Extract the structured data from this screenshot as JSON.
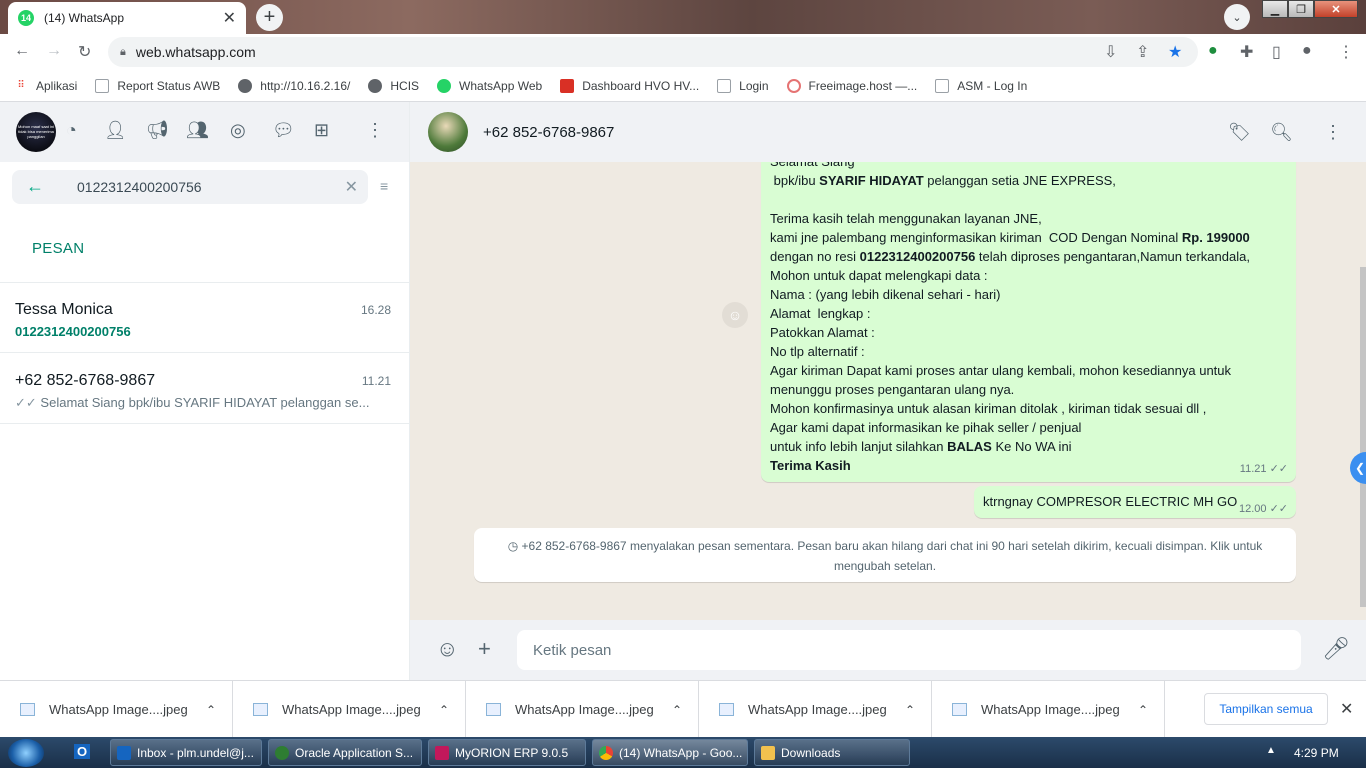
{
  "browser": {
    "tab_title": "(14) WhatsApp",
    "tab_badge": "14",
    "url": "web.whatsapp.com",
    "bookmarks": [
      {
        "label": "Aplikasi",
        "color": "#ea4335"
      },
      {
        "label": "Report Status AWB",
        "color": "#9aa0a6"
      },
      {
        "label": "http://10.16.2.16/",
        "color": "#5f6368"
      },
      {
        "label": "HCIS",
        "color": "#5f6368"
      },
      {
        "label": "WhatsApp Web",
        "color": "#25d366"
      },
      {
        "label": "Dashboard HVO HV...",
        "color": "#d93025"
      },
      {
        "label": "Login",
        "color": "#9aa0a6"
      },
      {
        "label": "Freeimage.host —...",
        "color": "#e57373"
      },
      {
        "label": "ASM - Log In",
        "color": "#9aa0a6"
      }
    ]
  },
  "sidebar": {
    "avatar_text": "Mohon maaf saat ini tidak bisa menerima panggilan",
    "search_value": "0122312400200756",
    "section_label": "PESAN",
    "chats": [
      {
        "name": "Tessa Monica",
        "time": "16.28",
        "subtitle": "0122312400200756"
      },
      {
        "name": "+62 852-6768-9867",
        "time": "11.21",
        "subtitle": "Selamat Siang   bpk/ibu SYARIF HIDAYAT pelanggan se..."
      }
    ]
  },
  "conversation": {
    "contact_name": "+62 852-6768-9867",
    "message1": {
      "line_greeting": "Selamat Siang",
      "salutation_pre": " bpk/ibu ",
      "salutation_name": "SYARIF HIDAYAT",
      "salutation_post": " pelanggan setia JNE EXPRESS,",
      "line_thanks": "Terima kasih telah menggunakan layanan JNE,",
      "cod_pre": "kami jne palembang menginformasikan kiriman  COD Dengan Nominal ",
      "cod_amount": "Rp. 199000",
      "cod_mid": " dengan no resi ",
      "cod_resi": "0122312400200756",
      "cod_post": " telah diproses pengantaran,Namun terkandala, Mohon untuk dapat melengkapi data :",
      "field_nama": "Nama : (yang lebih dikenal sehari - hari)",
      "field_alamat": "Alamat  lengkap :",
      "field_patokan": "Patokkan Alamat :",
      "field_tlp": "No tlp alternatif :",
      "line_agar": "Agar kiriman Dapat kami proses antar ulang kembali, mohon kesediannya untuk menunggu proses pengantaran ulang nya.",
      "line_konfirmasi": "Mohon konfirmasinya untuk alasan kiriman ditolak , kiriman tidak sesuai dll ,",
      "line_seller": "Agar kami dapat informasikan ke pihak seller / penjual",
      "balas_pre": "untuk info lebih lanjut silahkan ",
      "balas_word": "BALAS",
      "balas_post": " Ke No WA ini",
      "closing": "Terima Kasih",
      "time": "11.21"
    },
    "message2": {
      "text": "ktrngnay COMPRESOR ELECTRIC MH GO",
      "time": "12.00"
    },
    "system_notice": "+62 852-6768-9867 menyalakan pesan sementara. Pesan baru akan hilang dari chat ini 90 hari setelah dikirim, kecuali disimpan. Klik untuk mengubah setelan.",
    "input_placeholder": "Ketik pesan"
  },
  "downloads": {
    "items": [
      "WhatsApp Image....jpeg",
      "WhatsApp Image....jpeg",
      "WhatsApp Image....jpeg",
      "WhatsApp Image....jpeg",
      "WhatsApp Image....jpeg"
    ],
    "show_all": "Tampilkan semua"
  },
  "taskbar": {
    "items": [
      "Inbox - plm.undel@j...",
      "Oracle Application S...",
      "MyORION ERP 9.0.5",
      "(14) WhatsApp - Goo...",
      "Downloads"
    ],
    "clock": "4:29 PM"
  },
  "colors": {
    "wa_green": "#00a884",
    "bubble_out": "#d9fdd3",
    "chat_bg": "#efeae2"
  }
}
